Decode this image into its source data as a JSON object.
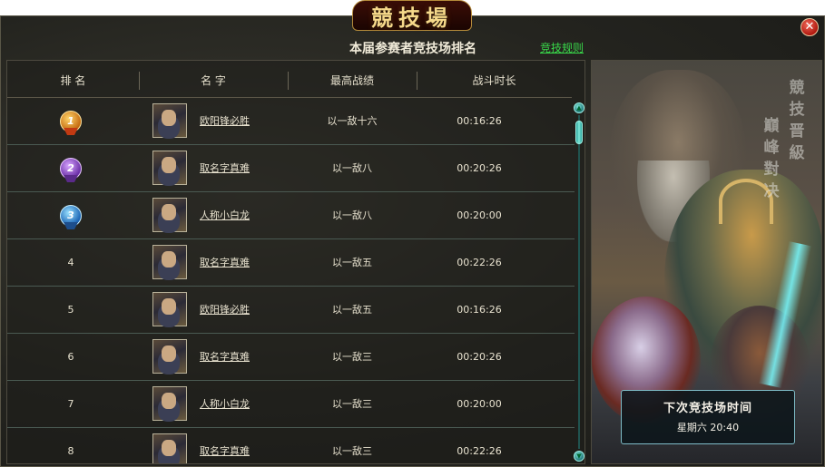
{
  "window": {
    "title": "競技場",
    "close_icon": "close-icon",
    "heading": "本届参赛者竞技场排名",
    "rules_link": "竞技规则"
  },
  "table": {
    "headers": {
      "rank": "排 名",
      "name": "名 字",
      "best": "最高战绩",
      "time": "战斗时长"
    },
    "rows": [
      {
        "rank": "1",
        "medal": "gold-medal-icon",
        "name": "欧阳锋必胜",
        "best": "以一敌十六",
        "time": "00:16:26"
      },
      {
        "rank": "2",
        "medal": "silver-medal-icon",
        "name": "取名字真难",
        "best": "以一敌八",
        "time": "00:20:26"
      },
      {
        "rank": "3",
        "medal": "bronze-medal-icon",
        "name": "人称小白龙",
        "best": "以一敌八",
        "time": "00:20:00"
      },
      {
        "rank": "4",
        "name": "取名字真难",
        "best": "以一敌五",
        "time": "00:22:26"
      },
      {
        "rank": "5",
        "name": "欧阳锋必胜",
        "best": "以一敌五",
        "time": "00:16:26"
      },
      {
        "rank": "6",
        "name": "取名字真难",
        "best": "以一敌三",
        "time": "00:20:26"
      },
      {
        "rank": "7",
        "name": "人称小白龙",
        "best": "以一敌三",
        "time": "00:20:00"
      },
      {
        "rank": "8",
        "name": "取名字真难",
        "best": "以一敌三",
        "time": "00:22:26"
      }
    ],
    "scroll_up_icon": "arrow-up-icon",
    "scroll_down_icon": "arrow-down-icon"
  },
  "side_panel": {
    "vertical_text": [
      "競技晋級",
      "巔峰對决"
    ],
    "next_label": "下次竞技场时间",
    "next_value": "星期六  20:40"
  },
  "colors": {
    "link": "#39d94a",
    "background": "#24241f",
    "accent_teal": "#7fe7d8",
    "title_gold": "#f6d98a"
  }
}
